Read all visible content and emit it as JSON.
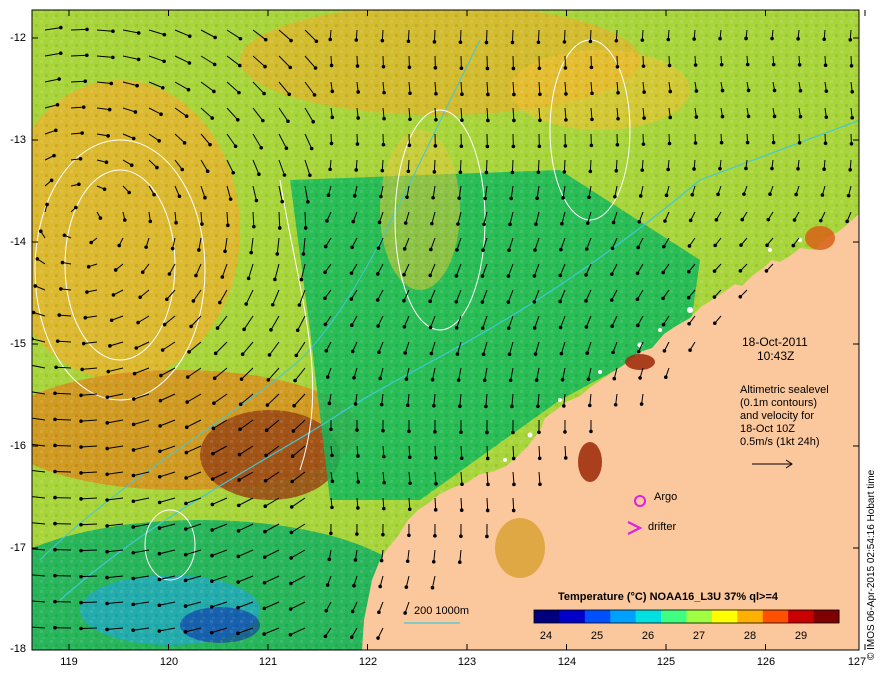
{
  "map": {
    "y_labels": [
      "-12",
      "-13",
      "-14",
      "-15",
      "-16",
      "-17",
      "-18"
    ],
    "x_labels": [
      "119",
      "120",
      "121",
      "122",
      "123",
      "124",
      "125",
      "126",
      "127"
    ],
    "lon_range": [
      118.6,
      126.9
    ],
    "lat_range": [
      -18,
      -11.9
    ]
  },
  "info": {
    "date": "18-Oct-2011",
    "time": "10:43Z",
    "alt_lines": [
      "Altimetric sealevel",
      "(0.1m contours)",
      "and velocity for",
      "18-Oct 10Z",
      "0.5m/s (1kt 24h)"
    ]
  },
  "legend": {
    "argo": "Argo",
    "drifter": "drifter",
    "bathy": "200  1000m"
  },
  "colorbar": {
    "title": "Temperature (°C) NOAA16_L3U 37% ql>=4",
    "labels": [
      "24",
      "25",
      "26",
      "27",
      "28",
      "29"
    ],
    "colors": [
      "#00007f",
      "#0000c8",
      "#0050ff",
      "#00a0ff",
      "#00e0e0",
      "#40ff80",
      "#a0ff40",
      "#ffff00",
      "#ffb000",
      "#ff5000",
      "#c80000",
      "#7f0000"
    ]
  },
  "credit": "© IMOS 06-Apr-2015 02:54:16 Hobart time",
  "palette": {
    "land": "#fbc79c",
    "sst_cool": "#00c26a",
    "sst_mid": "#a8d63a",
    "sst_warm": "#f0a020",
    "sst_hot": "#9a3010",
    "contour": "#ffffff",
    "bathy": "#40c8d8",
    "argo": "#e020e0"
  }
}
